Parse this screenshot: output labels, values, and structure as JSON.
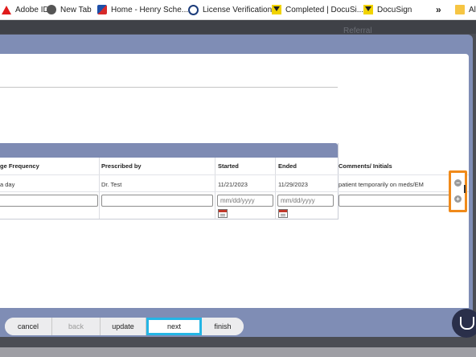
{
  "bookmarks": [
    {
      "icon": "adobe-icon",
      "label": "Adobe ID"
    },
    {
      "icon": "globe-icon",
      "label": "New Tab"
    },
    {
      "icon": "henry-schein-icon",
      "label": "Home - Henry Sche..."
    },
    {
      "icon": "license-icon",
      "label": "License Verification"
    },
    {
      "icon": "docusign-icon",
      "label": "Completed | DocuSi..."
    },
    {
      "icon": "docusign-icon",
      "label": "DocuSign"
    },
    {
      "label": "»"
    },
    {
      "icon": "folder-icon",
      "label": "All"
    }
  ],
  "background": {
    "referral_label": "Referral"
  },
  "table": {
    "columns": [
      "ge Frequency",
      "Prescribed by",
      "Started",
      "Ended",
      "Comments/ Initials"
    ],
    "rows": [
      {
        "frequency": "a day",
        "prescribed_by": "Dr. Test",
        "started": "11/21/2023",
        "ended": "11/29/2023",
        "comments": "patient temporarily on meds/EM"
      }
    ],
    "new_row": {
      "started_placeholder": "mm/dd/yyyy",
      "ended_placeholder": "mm/dd/yyyy"
    }
  },
  "row_controls": {
    "remove_symbol": "−",
    "add_symbol": "+"
  },
  "footer": {
    "buttons": [
      {
        "label": "cancel",
        "enabled": true
      },
      {
        "label": "back",
        "enabled": false
      },
      {
        "label": "update",
        "enabled": true
      },
      {
        "label": "next",
        "enabled": true,
        "highlighted": true
      },
      {
        "label": "finish",
        "enabled": true
      }
    ]
  },
  "colors": {
    "accent_highlight": "#24b5e5",
    "control_highlight": "#f08a1a",
    "modal_frame": "#7f8db5"
  }
}
